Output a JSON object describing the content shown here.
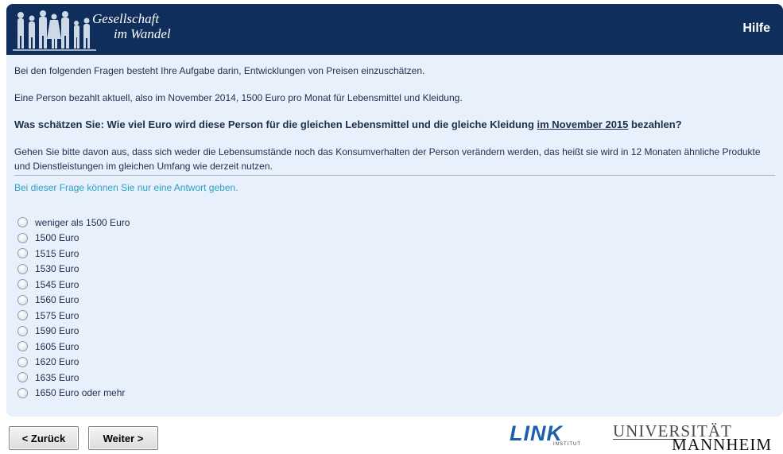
{
  "header": {
    "logo_line1": "Gesellschaft",
    "logo_line2": "im Wandel",
    "help_label": "Hilfe",
    "bg_color": "#0f2e5c"
  },
  "question": {
    "intro": "Bei den folgenden Fragen besteht Ihre Aufgabe darin, Entwicklungen von Preisen einzuschätzen.",
    "context": "Eine Person bezahlt aktuell, also im November 2014, 1500 Euro pro Monat für Lebensmittel und Kleidung.",
    "prompt_before": "Was schätzen Sie: Wie viel Euro wird diese Person für die gleichen Lebensmittel und die gleiche Kleidung ",
    "prompt_underlined": "im November 2015",
    "prompt_after": " bezahlen?",
    "assumption": "Gehen Sie bitte davon aus, dass sich weder die Lebensumstände noch das Konsumverhalten der Person verändern werden, das heißt sie wird in 12 Monaten ähnliche Produkte und Dienstleistungen im gleichen Umfang wie derzeit nutzen.",
    "hint": "Bei dieser Frage können Sie nur eine Antwort geben."
  },
  "options": [
    "weniger als 1500 Euro",
    "1500 Euro",
    "1515 Euro",
    "1530 Euro",
    "1545 Euro",
    "1560 Euro",
    "1575 Euro",
    "1590 Euro",
    "1605 Euro",
    "1620 Euro",
    "1635 Euro",
    "1650 Euro oder mehr"
  ],
  "navigation": {
    "back_label": "< Zurück",
    "next_label": "Weiter >"
  },
  "footer": {
    "link_logo_text": "LINK",
    "link_logo_sub": "INSTITUT",
    "uni_line1": "UNIVERSITÄT",
    "uni_line2": "MANNHEIM"
  }
}
